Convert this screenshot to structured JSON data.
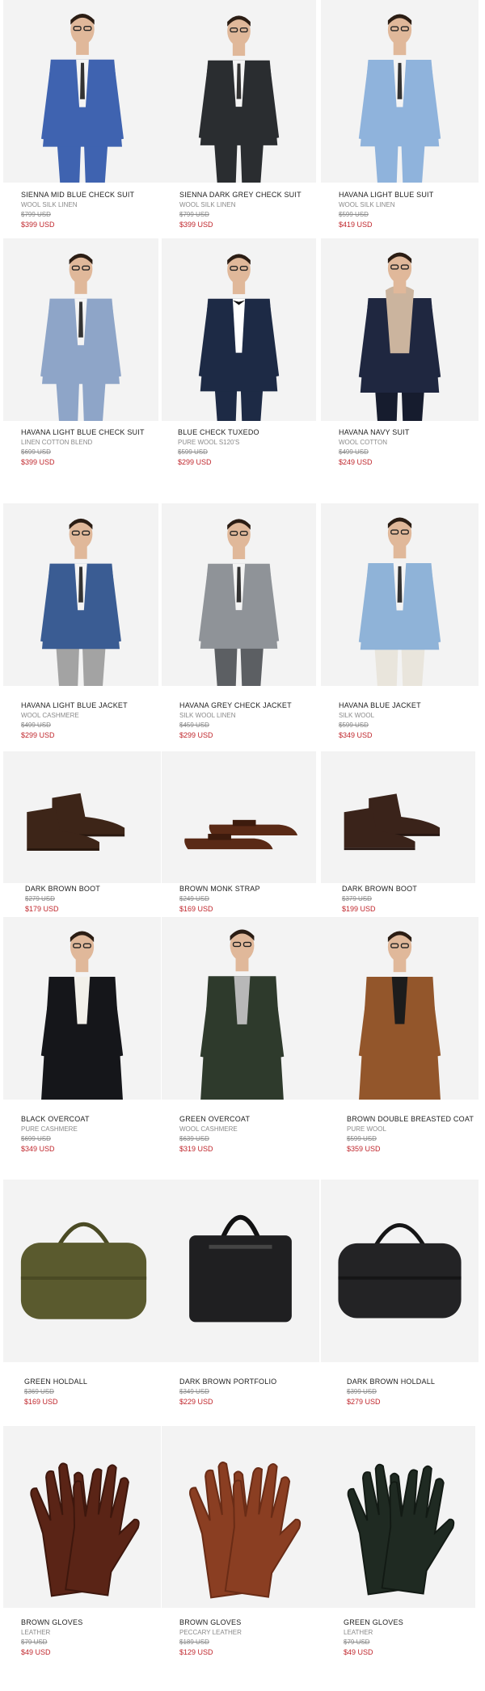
{
  "products": [
    {
      "name": "SIENNA MID BLUE CHECK SUIT",
      "material": "WOOL SILK LINEN",
      "old_price": "$799 USD",
      "price": "$399 USD",
      "category": "suit",
      "color": "#3f63b0",
      "color2": "#2d4f94"
    },
    {
      "name": "SIENNA DARK GREY CHECK SUIT",
      "material": "WOOL SILK LINEN",
      "old_price": "$799 USD",
      "price": "$399 USD",
      "category": "suit",
      "color": "#2a2d30",
      "color2": "#1c1e20"
    },
    {
      "name": "HAVANA LIGHT BLUE SUIT",
      "material": "WOOL SILK LINEN",
      "old_price": "$599 USD",
      "price": "$419 USD",
      "category": "suit",
      "color": "#8fb3dc",
      "color2": "#7aa1cf"
    },
    {
      "name": "HAVANA LIGHT BLUE CHECK SUIT",
      "material": "LINEN COTTON BLEND",
      "old_price": "$699 USD",
      "price": "$399 USD",
      "category": "suit",
      "color": "#8ea5c8",
      "color2": "#7d93b8"
    },
    {
      "name": "BLUE CHECK TUXEDO",
      "material": "PURE WOOL S120'S",
      "old_price": "$599 USD",
      "price": "$299 USD",
      "category": "tuxedo",
      "color": "#1d2a45",
      "color2": "#141d31"
    },
    {
      "name": "HAVANA NAVY SUIT",
      "material": "WOOL COTTON",
      "old_price": "$499 USD",
      "price": "$249 USD",
      "category": "jacket-hoodie",
      "color": "#1f2740",
      "color2": "#161c2e"
    },
    {
      "name": "HAVANA LIGHT BLUE JACKET",
      "material": "WOOL CASHMERE",
      "old_price": "$499 USD",
      "price": "$299 USD",
      "category": "jacket",
      "color": "#3a5c93",
      "color2": "#a3a3a3"
    },
    {
      "name": "HAVANA GREY CHECK JACKET",
      "material": "SILK WOOL LINEN",
      "old_price": "$459 USD",
      "price": "$299 USD",
      "category": "jacket",
      "color": "#8f9398",
      "color2": "#5c5f63"
    },
    {
      "name": "HAVANA BLUE JACKET",
      "material": "SILK WOOL",
      "old_price": "$599 USD",
      "price": "$349 USD",
      "category": "jacket",
      "color": "#8fb3d8",
      "color2": "#e9e5dc"
    },
    {
      "name": "DARK BROWN BOOT",
      "material": "",
      "old_price": "$279 USD",
      "price": "$179 USD",
      "category": "boot",
      "color": "#3d2518",
      "color2": "#2a1910"
    },
    {
      "name": "BROWN MONK STRAP",
      "material": "",
      "old_price": "$249 USD",
      "price": "$169 USD",
      "category": "shoe",
      "color": "#5a2a16",
      "color2": "#3d1b0d"
    },
    {
      "name": "DARK BROWN BOOT",
      "material": "",
      "old_price": "$379 USD",
      "price": "$199 USD",
      "category": "boot",
      "color": "#3a231a",
      "color2": "#261611"
    },
    {
      "name": "BLACK OVERCOAT",
      "material": "PURE CASHMERE",
      "old_price": "$699 USD",
      "price": "$349 USD",
      "category": "coat",
      "color": "#15161a",
      "color2": "#f2f0ea"
    },
    {
      "name": "GREEN OVERCOAT",
      "material": "WOOL CASHMERE",
      "old_price": "$639 USD",
      "price": "$319 USD",
      "category": "coat",
      "color": "#2e3a2c",
      "color2": "#b8b8b8"
    },
    {
      "name": "BROWN DOUBLE BREASTED COAT",
      "material": "PURE WOOL",
      "old_price": "$599 USD",
      "price": "$359 USD",
      "category": "coat",
      "color": "#93562b",
      "color2": "#1c1c1c"
    },
    {
      "name": "GREEN HOLDALL",
      "material": "",
      "old_price": "$369 USD",
      "price": "$169 USD",
      "category": "holdall",
      "color": "#5a5a2e",
      "color2": "#4a4a24"
    },
    {
      "name": "DARK BROWN PORTFOLIO",
      "material": "",
      "old_price": "$349 USD",
      "price": "$229 USD",
      "category": "portfolio",
      "color": "#1f1f21",
      "color2": "#111112"
    },
    {
      "name": "DARK BROWN HOLDALL",
      "material": "",
      "old_price": "$399 USD",
      "price": "$279 USD",
      "category": "holdall2",
      "color": "#232325",
      "color2": "#151516"
    },
    {
      "name": "BROWN GLOVES",
      "material": "LEATHER",
      "old_price": "$79 USD",
      "price": "$49 USD",
      "category": "gloves",
      "color": "#5a2416",
      "color2": "#3e170d"
    },
    {
      "name": "BROWN GLOVES",
      "material": "PECCARY LEATHER",
      "old_price": "$189 USD",
      "price": "$129 USD",
      "category": "gloves",
      "color": "#8a3e22",
      "color2": "#6a2c16"
    },
    {
      "name": "GREEN GLOVES",
      "material": "LEATHER",
      "old_price": "$79 USD",
      "price": "$49 USD",
      "category": "gloves",
      "color": "#1f2a22",
      "color2": "#121a14"
    }
  ]
}
